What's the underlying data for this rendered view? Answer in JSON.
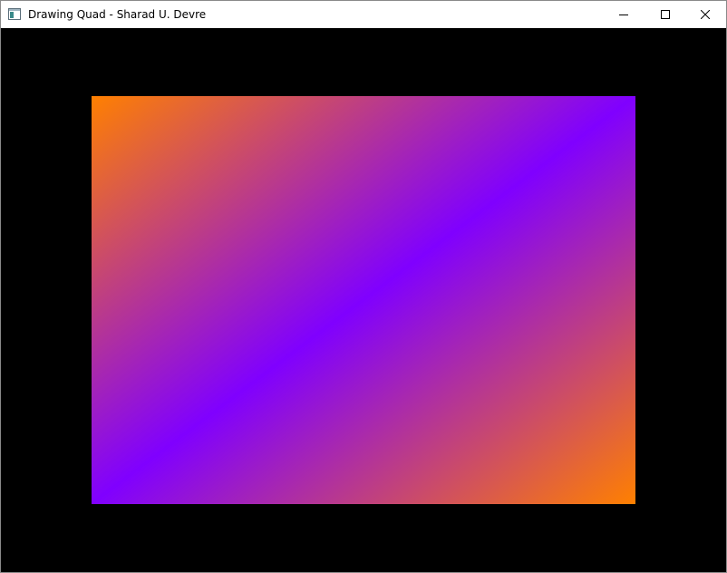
{
  "window": {
    "title": "Drawing Quad - Sharad U. Devre",
    "app_icon": "app-window-icon",
    "controls": {
      "minimize_icon": "minimize-icon",
      "maximize_icon": "maximize-icon",
      "close_icon": "close-icon"
    }
  },
  "canvas": {
    "background": "#000000",
    "quad": {
      "corner_colors": {
        "top_left": "#ff8000",
        "top_right": "#8000ff",
        "bottom_left": "#8000ff",
        "bottom_right": "#ff8000"
      }
    }
  }
}
